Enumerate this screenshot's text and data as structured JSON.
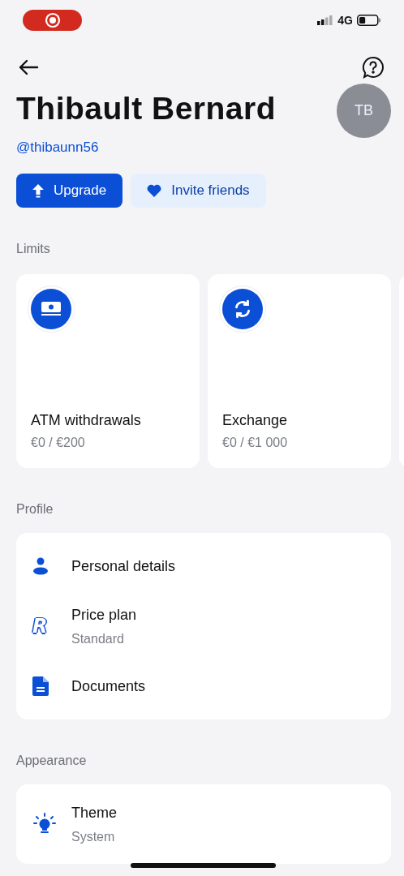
{
  "status_bar": {
    "network": "4G"
  },
  "header": {
    "name": "Thibault Bernard",
    "handle": "@thibaunn56",
    "avatar_initials": "TB"
  },
  "actions": [
    {
      "kind": "primary",
      "label": "Upgrade"
    },
    {
      "kind": "secondary",
      "label": "Invite friends"
    }
  ],
  "limits": {
    "title": "Limits",
    "cards": [
      {
        "kind": "cash",
        "title": "ATM withdrawals",
        "value": "€0 / €200"
      },
      {
        "kind": "exchange",
        "title": "Exchange",
        "value": "€0 / €1 000"
      }
    ]
  },
  "sections": [
    {
      "title": "Profile",
      "items": [
        {
          "kind": "person",
          "label": "Personal details"
        },
        {
          "kind": "logo",
          "icon_text": "R",
          "label": "Price plan",
          "sublabel": "Standard"
        },
        {
          "kind": "document",
          "label": "Documents"
        }
      ]
    },
    {
      "title": "Appearance",
      "items": [
        {
          "kind": "bulb",
          "label": "Theme",
          "sublabel": "System"
        }
      ]
    }
  ]
}
